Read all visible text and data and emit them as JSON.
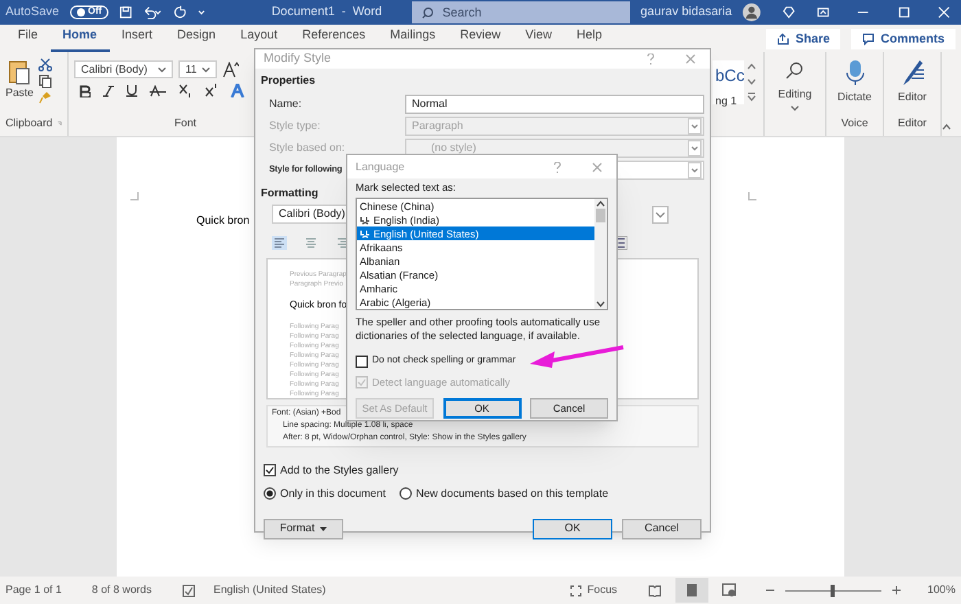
{
  "title_bar": {
    "autosave_label": "AutoSave",
    "autosave_toggle": {
      "label": "Off",
      "on": false
    },
    "document_title": "Document1  -  Word",
    "search": {
      "placeholder": "Search"
    },
    "user_name": "gaurav bidasaria"
  },
  "tabs": [
    {
      "label": "File",
      "selected": false
    },
    {
      "label": "Home",
      "selected": true
    },
    {
      "label": "Insert",
      "selected": false
    },
    {
      "label": "Design",
      "selected": false
    },
    {
      "label": "Layout",
      "selected": false
    },
    {
      "label": "References",
      "selected": false
    },
    {
      "label": "Mailings",
      "selected": false
    },
    {
      "label": "Review",
      "selected": false
    },
    {
      "label": "View",
      "selected": false
    },
    {
      "label": "Help",
      "selected": false
    }
  ],
  "share_button": "Share",
  "comments_button": "Comments",
  "ribbon": {
    "clipboard": {
      "paste": "Paste",
      "label": "Clipboard"
    },
    "font": {
      "font_name": "Calibri (Body)",
      "font_size": "11",
      "label": "Font"
    },
    "styles": {
      "preview": "bCc",
      "name": "ng 1"
    },
    "editing": {
      "label": "Editing"
    },
    "voice": {
      "button": "Dictate",
      "label": "Voice"
    },
    "editor": {
      "button": "Editor",
      "label": "Editor"
    }
  },
  "document": {
    "text": "Quick bron"
  },
  "modify_style": {
    "title": "Modify Style",
    "properties_heading": "Properties",
    "fields": [
      {
        "label": "Name:",
        "value": "Normal",
        "kind": "text",
        "disabled": false
      },
      {
        "label": "Style type:",
        "value": "Paragraph",
        "kind": "dropdown",
        "disabled": true
      },
      {
        "label": "Style based on:",
        "value": "(no style)",
        "kind": "dropdown",
        "disabled": true
      },
      {
        "label": "Style for following",
        "kind": "dropdown",
        "disabled": false
      }
    ],
    "formatting_heading": "Formatting",
    "font_name": "Calibri (Body)",
    "preview": {
      "previous": [
        "Previous Paragrap",
        "Paragraph Previo"
      ],
      "sample": "Quick bron fo",
      "following": [
        "Following Parag",
        "Following Parag",
        "Following Parag",
        "Following Parag",
        "Following Parag",
        "Following Parag",
        "Following Parag",
        "Following Parag"
      ]
    },
    "description": [
      "Font: (Asian) +Bod",
      "Line spacing:  Multiple 1.08 li, space",
      "After:  8 pt, Widow/Orphan control, Style: Show in the Styles gallery"
    ],
    "add_to_gallery": {
      "label": "Add to the Styles gallery",
      "checked": true
    },
    "scope": [
      {
        "label": "Only in this document",
        "selected": true
      },
      {
        "label": "New documents based on this template",
        "selected": false
      }
    ],
    "format_button": "Format",
    "ok_button": "OK",
    "cancel_button": "Cancel"
  },
  "language": {
    "title": "Language",
    "prompt": "Mark selected text as:",
    "languages": [
      {
        "label": "Chinese (China)",
        "selected": false,
        "proofing_icon": false
      },
      {
        "label": "English (India)",
        "selected": false,
        "proofing_icon": true
      },
      {
        "label": "English (United States)",
        "selected": true,
        "proofing_icon": true
      },
      {
        "label": "Afrikaans",
        "selected": false,
        "proofing_icon": false
      },
      {
        "label": "Albanian",
        "selected": false,
        "proofing_icon": false
      },
      {
        "label": "Alsatian (France)",
        "selected": false,
        "proofing_icon": false
      },
      {
        "label": "Amharic",
        "selected": false,
        "proofing_icon": false
      },
      {
        "label": "Arabic (Algeria)",
        "selected": false,
        "proofing_icon": false
      }
    ],
    "note": "The speller and other proofing tools automatically use dictionaries of the selected language, if available.",
    "no_proofing": {
      "label": "Do not check spelling or grammar",
      "checked": false,
      "disabled": false
    },
    "detect": {
      "label": "Detect language automatically",
      "checked": true,
      "disabled": true
    },
    "buttons": [
      {
        "label": "Set As Default",
        "disabled": true,
        "default": false
      },
      {
        "label": "OK",
        "disabled": false,
        "default": true
      },
      {
        "label": "Cancel",
        "disabled": false,
        "default": false
      }
    ]
  },
  "status_bar": {
    "page": "Page 1 of 1",
    "words": "8 of 8 words",
    "language": "English (United States)",
    "focus": "Focus",
    "zoom_slider": {
      "level": 0.5
    },
    "zoom": "100%"
  }
}
